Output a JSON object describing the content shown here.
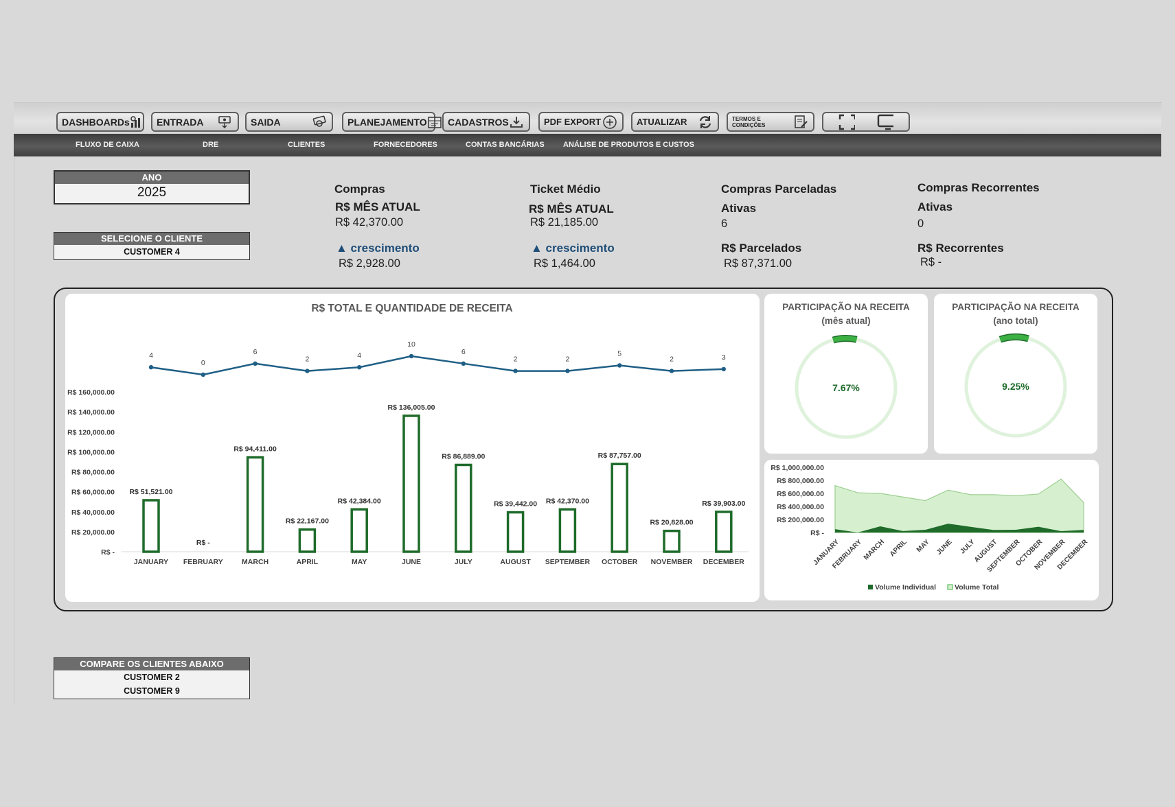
{
  "toolbar": {
    "buttons": [
      {
        "label": "DASHBOARDs",
        "icon": "dashboard-chart-icon"
      },
      {
        "label": "ENTRADA",
        "icon": "money-in-icon"
      },
      {
        "label": "SAIDA",
        "icon": "money-out-icon"
      },
      {
        "label": "PLANEJAMENTO",
        "icon": "planning-calendar-icon"
      },
      {
        "label": "CADASTROS",
        "icon": "download-tray-icon"
      },
      {
        "label": "PDF EXPORT",
        "icon": "plus-circle-icon"
      },
      {
        "label": "ATUALIZAR",
        "icon": "refresh-icon"
      },
      {
        "label": "TERMOS E CONDIÇÕES",
        "icon": "document-sign-icon"
      }
    ],
    "view_icons": [
      "fullscreen-icon",
      "monitor-icon"
    ]
  },
  "nav": [
    "FLUXO DE CAIXA",
    "DRE",
    "CLIENTES",
    "FORNECEDORES",
    "CONTAS BANCÁRIAS",
    "ANÁLISE DE PRODUTOS E CUSTOS"
  ],
  "filters": {
    "year_label": "ANO",
    "year_value": "2025",
    "client_label": "SELECIONE O CLIENTE",
    "client_value": "CUSTOMER 4",
    "compare_label": "COMPARE OS CLIENTES ABAIXO",
    "compare_values": [
      "CUSTOMER 2",
      "CUSTOMER 9"
    ]
  },
  "kpis": {
    "compras": {
      "title": "Compras",
      "subtitle": "R$ MÊS ATUAL",
      "value": "R$ 42,370.00",
      "growth_label": "▲ crescimento",
      "growth_value": "R$ 2,928.00"
    },
    "ticket": {
      "title": "Ticket Médio",
      "subtitle": "R$ MÊS ATUAL",
      "value": "R$ 21,185.00",
      "growth_label": "▲ crescimento",
      "growth_value": "R$ 1,464.00"
    },
    "parceladas": {
      "title": "Compras Parceladas",
      "subtitle": "Ativas",
      "value": "6",
      "money_label": "R$ Parcelados",
      "money_value": "R$ 87,371.00"
    },
    "recorrentes": {
      "title": "Compras Recorrentes",
      "subtitle": "Ativas",
      "value": "0",
      "money_label": "R$ Recorrentes",
      "money_value": "R$ -"
    }
  },
  "colors": {
    "bar": "#1e6b2a",
    "line": "#1f5f86",
    "donut_ring": "#dff2dc",
    "donut_arc": "#3cb043",
    "area_total": "#d6f0cf",
    "area_individual": "#1e6b2a"
  },
  "chart_data": [
    {
      "type": "bar",
      "title": "R$ TOTAL E QUANTIDADE DE RECEITA",
      "categories": [
        "JANUARY",
        "FEBRUARY",
        "MARCH",
        "APRIL",
        "MAY",
        "JUNE",
        "JULY",
        "AUGUST",
        "SEPTEMBER",
        "OCTOBER",
        "NOVEMBER",
        "DECEMBER"
      ],
      "series": [
        {
          "values": [
            51521,
            0,
            94411,
            22167,
            42384,
            136005,
            86889,
            39442,
            42370,
            87757,
            20828,
            39903
          ]
        },
        {
          "type": "line",
          "values": [
            4,
            0,
            6,
            2,
            4,
            10,
            6,
            2,
            2,
            5,
            2,
            3
          ]
        }
      ],
      "bar_labels": [
        "R$ 51,521.00",
        "R$ -",
        "R$ 94,411.00",
        "R$ 22,167.00",
        "R$ 42,384.00",
        "R$ 136,005.00",
        "R$ 86,889.00",
        "R$ 39,442.00",
        "R$ 42,370.00",
        "R$ 87,757.00",
        "R$ 20,828.00",
        "R$ 39,903.00"
      ],
      "ylim": [
        0,
        160000
      ],
      "y_ticks": [
        "R$ -",
        "R$ 20,000.00",
        "R$ 40,000.00",
        "R$ 60,000.00",
        "R$ 80,000.00",
        "R$ 100,000.00",
        "R$ 120,000.00",
        "R$ 140,000.00",
        "R$ 160,000.00"
      ],
      "grid": false
    },
    {
      "type": "pie",
      "title": "PARTICIPAÇÃO NA RECEITA",
      "subtitle": "(mês atual)",
      "value": 7.67,
      "label": "7.67%"
    },
    {
      "type": "pie",
      "title": "PARTICIPAÇÃO NA RECEITA",
      "subtitle": "(ano total)",
      "value": 9.25,
      "label": "9.25%"
    },
    {
      "type": "area",
      "categories": [
        "JANUARY",
        "FEBRUARY",
        "MARCH",
        "APRIL",
        "MAY",
        "JUNE",
        "JULY",
        "AUGUST",
        "SEPTEMBER",
        "OCTOBER",
        "NOVEMBER",
        "DECEMBER"
      ],
      "series": [
        {
          "name": "Volume Individual",
          "values": [
            51521,
            0,
            94411,
            22167,
            42384,
            136005,
            86889,
            39442,
            42370,
            87757,
            20828,
            39903
          ]
        },
        {
          "name": "Volume Total",
          "values": [
            720000,
            610000,
            600000,
            545000,
            490000,
            650000,
            580000,
            580000,
            565000,
            590000,
            820000,
            460000
          ]
        }
      ],
      "ylim": [
        0,
        1000000
      ],
      "y_ticks": [
        "R$ -",
        "R$ 200,000.00",
        "R$ 400,000.00",
        "R$ 600,000.00",
        "R$ 800,000.00",
        "R$ 1,000,000.00"
      ],
      "legend": "bottom"
    }
  ]
}
